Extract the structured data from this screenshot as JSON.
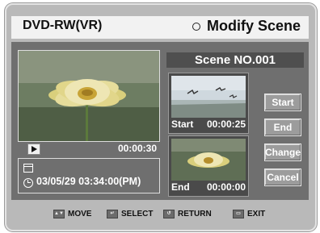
{
  "header": {
    "mode": "DVD-RW(VR)",
    "screen_title": "Modify Scene"
  },
  "preview": {
    "time": "00:00:30",
    "datetime": "03/05/29 03:34:00(PM)"
  },
  "scene": {
    "title": "Scene NO.001",
    "start_label": "Start",
    "start_time": "00:00:25",
    "end_label": "End",
    "end_time": "00:00:00"
  },
  "buttons": {
    "start": "Start",
    "end": "End",
    "change": "Change",
    "cancel": "Cancel"
  },
  "footer": {
    "move": "MOVE",
    "select": "SELECT",
    "return": "RETURN",
    "exit": "EXIT"
  },
  "colors": {
    "panel": "#6f6f6f",
    "frame": "#b9b9b9",
    "header_bg": "#f2f2f2",
    "title_bar": "#4f4f4f"
  },
  "icons": [
    "circle-icon",
    "play-icon",
    "disc-icon",
    "clock-icon",
    "move-key-icon",
    "select-key-icon",
    "return-key-icon",
    "exit-key-icon"
  ]
}
